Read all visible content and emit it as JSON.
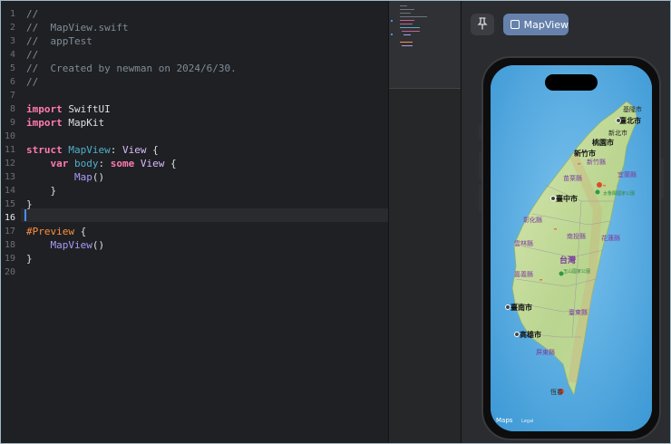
{
  "editor": {
    "line_numbers": [
      "1",
      "2",
      "3",
      "4",
      "5",
      "6",
      "7",
      "8",
      "9",
      "10",
      "11",
      "12",
      "13",
      "14",
      "15",
      "16",
      "17",
      "18",
      "19",
      "20"
    ],
    "current_line": "16",
    "lines": [
      [
        {
          "t": "//",
          "c": "cm"
        }
      ],
      [
        {
          "t": "//  MapView.swift",
          "c": "cm"
        }
      ],
      [
        {
          "t": "//  appTest",
          "c": "cm"
        }
      ],
      [
        {
          "t": "//",
          "c": "cm"
        }
      ],
      [
        {
          "t": "//  Created by newman on 2024/6/30.",
          "c": "cm"
        }
      ],
      [
        {
          "t": "//",
          "c": "cm"
        }
      ],
      [],
      [
        {
          "t": "import",
          "c": "kw"
        },
        {
          "t": " SwiftUI",
          "c": ""
        }
      ],
      [
        {
          "t": "import",
          "c": "kw"
        },
        {
          "t": " MapKit",
          "c": ""
        }
      ],
      [],
      [
        {
          "t": "struct",
          "c": "kw"
        },
        {
          "t": " ",
          "c": ""
        },
        {
          "t": "MapView",
          "c": "dc"
        },
        {
          "t": ": ",
          "c": ""
        },
        {
          "t": "View",
          "c": "ty"
        },
        {
          "t": " {",
          "c": ""
        }
      ],
      [
        {
          "t": "    ",
          "c": ""
        },
        {
          "t": "var",
          "c": "kw"
        },
        {
          "t": " ",
          "c": ""
        },
        {
          "t": "body",
          "c": "dc"
        },
        {
          "t": ": ",
          "c": ""
        },
        {
          "t": "some",
          "c": "kw"
        },
        {
          "t": " ",
          "c": ""
        },
        {
          "t": "View",
          "c": "ty"
        },
        {
          "t": " {",
          "c": ""
        }
      ],
      [
        {
          "t": "        ",
          "c": ""
        },
        {
          "t": "Map",
          "c": "fn"
        },
        {
          "t": "()",
          "c": ""
        }
      ],
      [
        {
          "t": "    }",
          "c": ""
        }
      ],
      [
        {
          "t": "}",
          "c": ""
        }
      ],
      [],
      [
        {
          "t": "#Preview",
          "c": "mc"
        },
        {
          "t": " {",
          "c": ""
        }
      ],
      [
        {
          "t": "    ",
          "c": ""
        },
        {
          "t": "MapView",
          "c": "fn"
        },
        {
          "t": "()",
          "c": ""
        }
      ],
      [
        {
          "t": "}",
          "c": ""
        }
      ],
      []
    ]
  },
  "canvas": {
    "pin_icon": "pin-icon",
    "preview_chip_label": "MapView",
    "preview_chip_icon": "device-icon"
  },
  "map": {
    "attribution": "Maps",
    "legal": "Legal",
    "labels": {
      "taipei": "臺北市",
      "newtaipei": "新北市",
      "taoyuan": "桃園市",
      "hsinchu": "新竹市",
      "hsinchu_county": "新竹縣",
      "miaoli": "苗栗縣",
      "taichung": "臺中市",
      "changhua": "彰化縣",
      "nantou": "南投縣",
      "yunlin": "雲林縣",
      "chiayi": "嘉義縣",
      "taiwan": "台灣",
      "tainan": "臺南市",
      "kaohsiung": "高雄市",
      "pingtung": "屏東縣",
      "taitung": "臺東縣",
      "hualien": "花蓮縣",
      "yilan": "宜蘭縣",
      "keelung": "基隆市",
      "yushan": "玉山國家公園",
      "taroko": "太魯閣國家公園",
      "hengchun": "恆春"
    }
  }
}
